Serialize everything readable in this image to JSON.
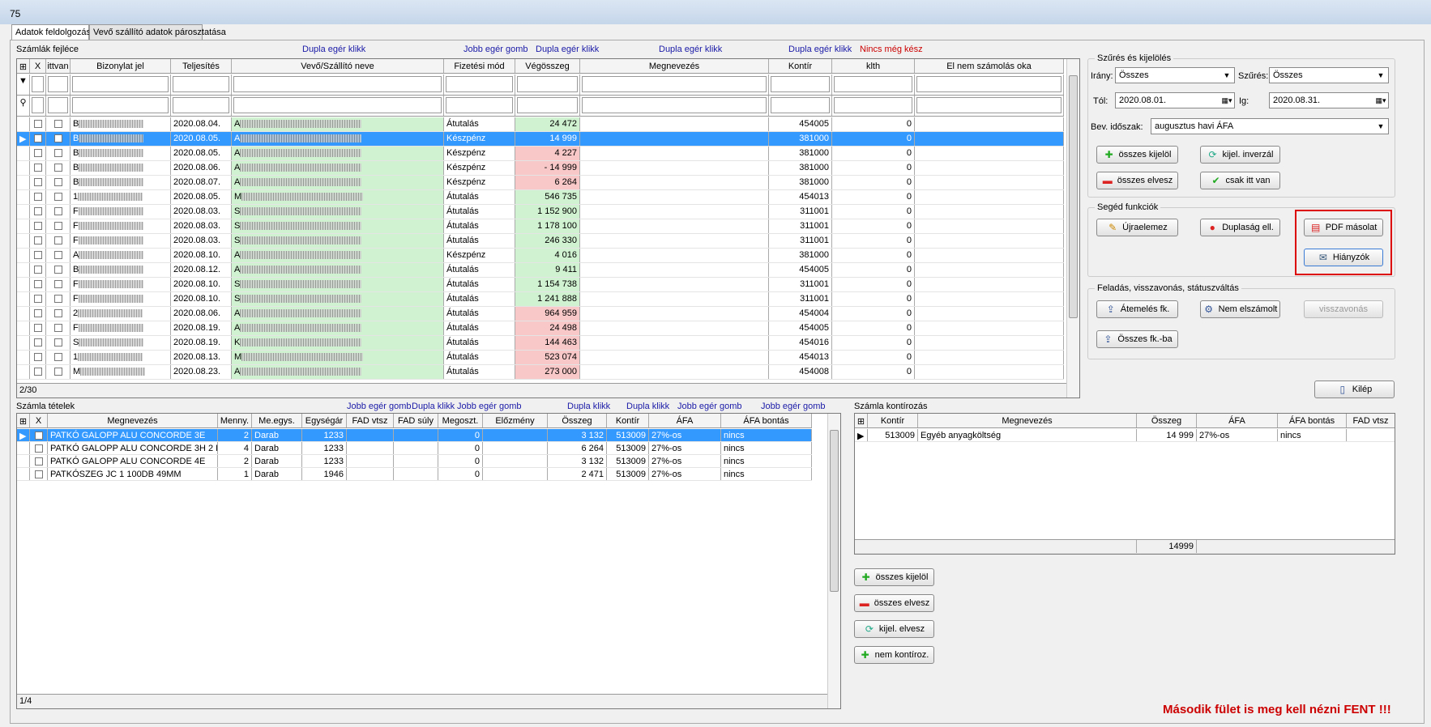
{
  "window": {
    "title": "75"
  },
  "tabs": [
    "Adatok feldolgozása",
    "Vevő szállító adatok párosztatása"
  ],
  "header_section": {
    "title": "Számlák fejléce",
    "hints": {
      "h1": "Dupla egér klikk",
      "h2": "Jobb egér gomb",
      "h3": "Dupla egér klikk",
      "h4": "Dupla egér klikk",
      "h5": "Dupla egér klikk",
      "h6": "Nincs még kész"
    }
  },
  "invoice_grid": {
    "columns": [
      "X",
      "ittvan",
      "Bizonylat jel",
      "Teljesítés",
      "Vevő/Szállító neve",
      "Fizetési mód",
      "Végösszeg",
      "Megnevezés",
      "Kontír",
      "klth",
      "El nem számolás oka"
    ],
    "rows": [
      {
        "bizonylat": "B",
        "telj": "2020.08.04.",
        "vevo": "A",
        "fiz": "Átutalás",
        "veg": "24 472",
        "kontir": "454005",
        "klth": "0",
        "color": "green"
      },
      {
        "bizonylat": "B",
        "telj": "2020.08.05.",
        "vevo": "A",
        "fiz": "Készpénz",
        "veg": "14 999",
        "kontir": "381000",
        "klth": "0",
        "color": "green"
      },
      {
        "bizonylat": "B",
        "telj": "2020.08.05.",
        "vevo": "A",
        "fiz": "Készpénz",
        "veg": "4 227",
        "kontir": "381000",
        "klth": "0",
        "color": "pink"
      },
      {
        "bizonylat": "B",
        "telj": "2020.08.06.",
        "vevo": "A",
        "fiz": "Készpénz",
        "veg": "- 14 999",
        "kontir": "381000",
        "klth": "0",
        "color": "pink"
      },
      {
        "bizonylat": "B",
        "telj": "2020.08.07.",
        "vevo": "A",
        "fiz": "Készpénz",
        "veg": "6 264",
        "kontir": "381000",
        "klth": "0",
        "color": "pink"
      },
      {
        "bizonylat": "1",
        "telj": "2020.08.05.",
        "vevo": "M",
        "fiz": "Átutalás",
        "veg": "546 735",
        "kontir": "454013",
        "klth": "0",
        "color": "green"
      },
      {
        "bizonylat": "F",
        "telj": "2020.08.03.",
        "vevo": "S",
        "fiz": "Átutalás",
        "veg": "1 152 900",
        "kontir": "311001",
        "klth": "0",
        "color": "green"
      },
      {
        "bizonylat": "F",
        "telj": "2020.08.03.",
        "vevo": "S",
        "fiz": "Átutalás",
        "veg": "1 178 100",
        "kontir": "311001",
        "klth": "0",
        "color": "green"
      },
      {
        "bizonylat": "F",
        "telj": "2020.08.03.",
        "vevo": "S",
        "fiz": "Átutalás",
        "veg": "246 330",
        "kontir": "311001",
        "klth": "0",
        "color": "green"
      },
      {
        "bizonylat": "A",
        "telj": "2020.08.10.",
        "vevo": "A",
        "fiz": "Készpénz",
        "veg": "4 016",
        "kontir": "381000",
        "klth": "0",
        "color": "green"
      },
      {
        "bizonylat": "B",
        "telj": "2020.08.12.",
        "vevo": "A",
        "fiz": "Átutalás",
        "veg": "9 411",
        "kontir": "454005",
        "klth": "0",
        "color": "green"
      },
      {
        "bizonylat": "F",
        "telj": "2020.08.10.",
        "vevo": "S",
        "fiz": "Átutalás",
        "veg": "1 154 738",
        "kontir": "311001",
        "klth": "0",
        "color": "green"
      },
      {
        "bizonylat": "F",
        "telj": "2020.08.10.",
        "vevo": "S",
        "fiz": "Átutalás",
        "veg": "1 241 888",
        "kontir": "311001",
        "klth": "0",
        "color": "green"
      },
      {
        "bizonylat": "2",
        "telj": "2020.08.06.",
        "vevo": "A",
        "fiz": "Átutalás",
        "veg": "964 959",
        "kontir": "454004",
        "klth": "0",
        "color": "pink"
      },
      {
        "bizonylat": "F",
        "telj": "2020.08.19.",
        "vevo": "A",
        "fiz": "Átutalás",
        "veg": "24 498",
        "kontir": "454005",
        "klth": "0",
        "color": "pink"
      },
      {
        "bizonylat": "S",
        "telj": "2020.08.19.",
        "vevo": "K",
        "fiz": "Átutalás",
        "veg": "144 463",
        "kontir": "454016",
        "klth": "0",
        "color": "pink"
      },
      {
        "bizonylat": "1",
        "telj": "2020.08.13.",
        "vevo": "M",
        "fiz": "Átutalás",
        "veg": "523 074",
        "kontir": "454013",
        "klth": "0",
        "color": "pink"
      },
      {
        "bizonylat": "M",
        "telj": "2020.08.23.",
        "vevo": "A",
        "fiz": "Átutalás",
        "veg": "273 000",
        "kontir": "454008",
        "klth": "0",
        "color": "pink"
      }
    ],
    "footer": "2/30"
  },
  "filter_group": {
    "title": "Szűrés és kijelölés",
    "irany_label": "Irány:",
    "irany_value": "Összes",
    "szures_label": "Szűrés:",
    "szures_value": "Összes",
    "tol_label": "Tól:",
    "tol_value": "2020.08.01.",
    "ig_label": "Ig:",
    "ig_value": "2020.08.31.",
    "bev_label": "Bev. időszak:",
    "bev_value": "augusztus havi ÁFA",
    "buttons": {
      "osszes_kijelol": "összes kijelöl",
      "kijel_inverzal": "kijel. inverzál",
      "osszes_elvesz": "összes elvesz",
      "csak_itt_van": "csak itt van"
    }
  },
  "helper_group": {
    "title": "Segéd funkciók",
    "buttons": {
      "ujraelemez": "Újraelemez",
      "duplasag": "Duplaság ell.",
      "pdf": "PDF másolat",
      "hianyzok": "Hiányzók"
    }
  },
  "post_group": {
    "title": "Feladás, visszavonás, státuszváltás",
    "buttons": {
      "atemeles": "Átemelés fk.",
      "nem_elszamolt": "Nem elszámolt",
      "visszavonas": "visszavonás",
      "osszes_fk": "Összes fk.-ba"
    }
  },
  "exit_button": "Kilép",
  "items_section": {
    "title": "Számla tételek",
    "hints": {
      "h1": "Jobb egér gomb",
      "h2": "Dupla klikk",
      "h3": "Jobb egér gomb",
      "h4": "Dupla klikk",
      "h5": "Dupla klikk",
      "h6": "Jobb egér gomb",
      "h7": "Jobb egér gomb"
    },
    "columns": [
      "X",
      "Megnevezés",
      "Menny.",
      "Me.egys.",
      "Egységár",
      "FAD vtsz",
      "FAD súly",
      "Megoszt.",
      "Előzmény",
      "Összeg",
      "Kontír",
      "ÁFA",
      "ÁFA bontás"
    ],
    "rows": [
      {
        "nev": "PATKÓ GALOPP ALU CONCORDE 3E",
        "menny": "2",
        "me": "Darab",
        "ar": "1233",
        "meg": "0",
        "osszeg": "3 132",
        "kontir": "513009",
        "afa": "27%-os",
        "bontas": "nincs"
      },
      {
        "nev": "PATKÓ GALOPP ALU CONCORDE 3H 2 K/",
        "menny": "4",
        "me": "Darab",
        "ar": "1233",
        "meg": "0",
        "osszeg": "6 264",
        "kontir": "513009",
        "afa": "27%-os",
        "bontas": "nincs"
      },
      {
        "nev": "PATKÓ GALOPP ALU CONCORDE 4E",
        "menny": "2",
        "me": "Darab",
        "ar": "1233",
        "meg": "0",
        "osszeg": "3 132",
        "kontir": "513009",
        "afa": "27%-os",
        "bontas": "nincs"
      },
      {
        "nev": "PATKÓSZEG JC  1 100DB  49MM",
        "menny": "1",
        "me": "Darab",
        "ar": "1946",
        "meg": "0",
        "osszeg": "2 471",
        "kontir": "513009",
        "afa": "27%-os",
        "bontas": "nincs"
      }
    ],
    "footer": "1/4"
  },
  "kontir_section": {
    "title": "Számla kontírozás",
    "columns": [
      "Kontír",
      "Megnevezés",
      "Összeg",
      "ÁFA",
      "ÁFA bontás",
      "FAD vtsz"
    ],
    "rows": [
      {
        "kontir": "513009",
        "nev": "Egyéb anyagköltség",
        "osszeg": "14 999",
        "afa": "27%-os",
        "bontas": "nincs"
      }
    ],
    "total": "14999",
    "buttons": {
      "osszes_kijelol": "összes kijelöl",
      "osszes_elvesz": "összes elvesz",
      "kijel_elvesz": "kijel. elvesz",
      "nem_kontiroz": "nem kontíroz."
    }
  },
  "note": "Második fület is meg kell nézni FENT !!!"
}
